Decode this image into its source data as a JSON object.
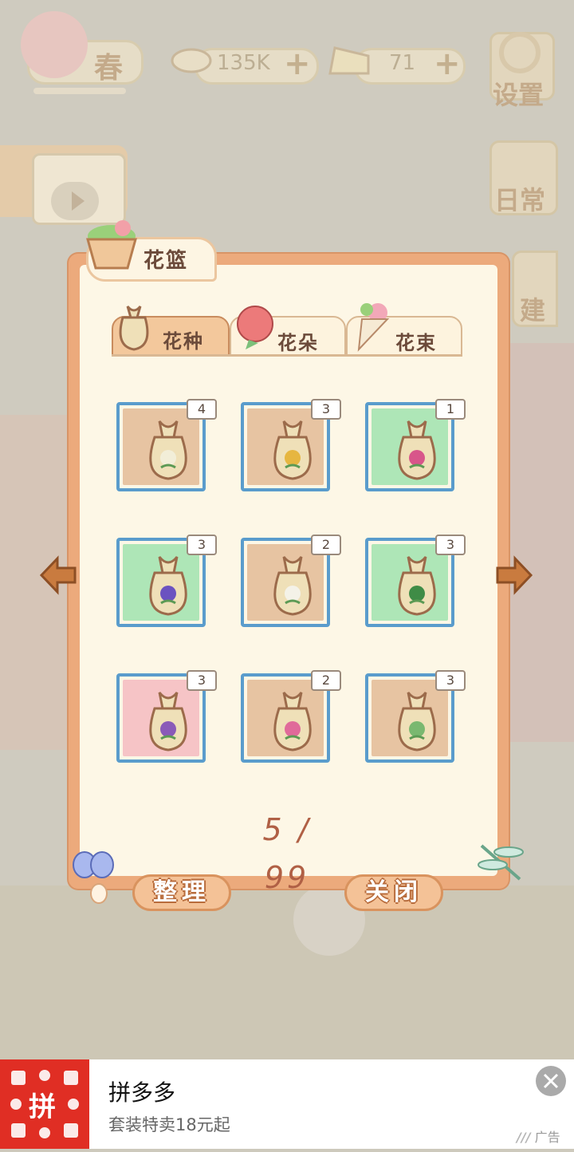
{
  "hud": {
    "season_label": "春",
    "fish_amount": "135K",
    "cheese_amount": "71",
    "settings_label": "设置",
    "daily_label": "日常",
    "build_label": "建"
  },
  "panel": {
    "title": "花篮",
    "tabs": [
      {
        "label": "花种",
        "active": true
      },
      {
        "label": "花朵",
        "active": false
      },
      {
        "label": "花束",
        "active": false
      }
    ],
    "slots": [
      {
        "count": "4",
        "bg": "#e7c4a2",
        "flower": "white-flower-icon",
        "flower_color": "#f2eed8"
      },
      {
        "count": "3",
        "bg": "#e7c4a2",
        "flower": "yellow-flower-icon",
        "flower_color": "#e6b640"
      },
      {
        "count": "1",
        "bg": "#aee6b7",
        "flower": "pink-flower-icon",
        "flower_color": "#d8568a"
      },
      {
        "count": "3",
        "bg": "#aee6b7",
        "flower": "purple-flower-icon",
        "flower_color": "#6b52c0"
      },
      {
        "count": "2",
        "bg": "#e7c4a2",
        "flower": "white-lily-icon",
        "flower_color": "#f4f2e8"
      },
      {
        "count": "3",
        "bg": "#aee6b7",
        "flower": "green-plant-icon",
        "flower_color": "#3f8c46"
      },
      {
        "count": "3",
        "bg": "#f6c4c6",
        "flower": "lavender-icon",
        "flower_color": "#8a5ab8"
      },
      {
        "count": "2",
        "bg": "#e7c4a2",
        "flower": "peony-icon",
        "flower_color": "#e06a9a"
      },
      {
        "count": "3",
        "bg": "#e7c4a2",
        "flower": "herb-icon",
        "flower_color": "#7ab870"
      }
    ],
    "page_counter": "5 / 99",
    "sort_button": "整理",
    "close_button": "关闭"
  },
  "ad": {
    "app_name": "拼多多",
    "subtitle": "套装特卖18元起",
    "logo_text": "拼",
    "tag": "广告"
  }
}
